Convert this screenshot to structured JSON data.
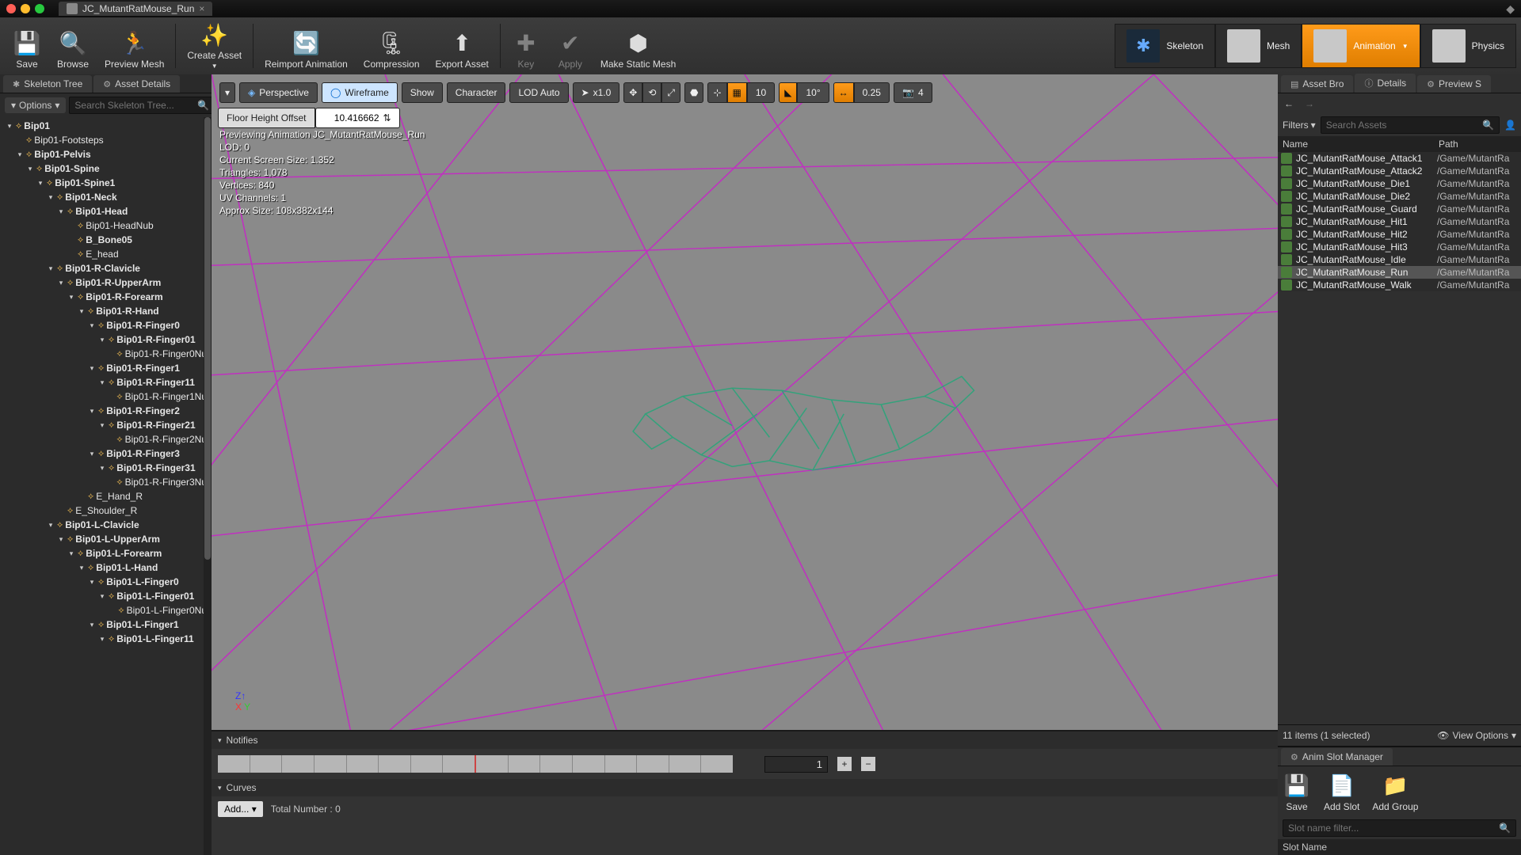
{
  "titlebar": {
    "tab_title": "JC_MutantRatMouse_Run"
  },
  "toolbar": {
    "save": "Save",
    "browse": "Browse",
    "preview_mesh": "Preview Mesh",
    "create_asset": "Create Asset",
    "reimport": "Reimport Animation",
    "compression": "Compression",
    "export": "Export Asset",
    "key": "Key",
    "apply": "Apply",
    "make_static": "Make Static Mesh"
  },
  "modes": {
    "skeleton": "Skeleton",
    "mesh": "Mesh",
    "animation": "Animation",
    "physics": "Physics"
  },
  "inner_tabs": {
    "skeleton_tree": "Skeleton Tree",
    "asset_details": "Asset Details"
  },
  "options_label": "Options",
  "search": {
    "placeholder": "Search Skeleton Tree..."
  },
  "bones": [
    {
      "d": 0,
      "t": "Bip01",
      "b": 1,
      "e": 1
    },
    {
      "d": 1,
      "t": "Bip01-Footsteps",
      "b": 0,
      "e": 0
    },
    {
      "d": 1,
      "t": "Bip01-Pelvis",
      "b": 1,
      "e": 1
    },
    {
      "d": 2,
      "t": "Bip01-Spine",
      "b": 1,
      "e": 1
    },
    {
      "d": 3,
      "t": "Bip01-Spine1",
      "b": 1,
      "e": 1
    },
    {
      "d": 4,
      "t": "Bip01-Neck",
      "b": 1,
      "e": 1
    },
    {
      "d": 5,
      "t": "Bip01-Head",
      "b": 1,
      "e": 1
    },
    {
      "d": 6,
      "t": "Bip01-HeadNub",
      "b": 0,
      "e": 0
    },
    {
      "d": 6,
      "t": "B_Bone05",
      "b": 1,
      "e": 0
    },
    {
      "d": 6,
      "t": "E_head",
      "b": 0,
      "e": 0
    },
    {
      "d": 4,
      "t": "Bip01-R-Clavicle",
      "b": 1,
      "e": 1
    },
    {
      "d": 5,
      "t": "Bip01-R-UpperArm",
      "b": 1,
      "e": 1
    },
    {
      "d": 6,
      "t": "Bip01-R-Forearm",
      "b": 1,
      "e": 1
    },
    {
      "d": 7,
      "t": "Bip01-R-Hand",
      "b": 1,
      "e": 1
    },
    {
      "d": 8,
      "t": "Bip01-R-Finger0",
      "b": 1,
      "e": 1
    },
    {
      "d": 9,
      "t": "Bip01-R-Finger01",
      "b": 1,
      "e": 1
    },
    {
      "d": 10,
      "t": "Bip01-R-Finger0Nu",
      "b": 0,
      "e": 0
    },
    {
      "d": 8,
      "t": "Bip01-R-Finger1",
      "b": 1,
      "e": 1
    },
    {
      "d": 9,
      "t": "Bip01-R-Finger11",
      "b": 1,
      "e": 1
    },
    {
      "d": 10,
      "t": "Bip01-R-Finger1Nu",
      "b": 0,
      "e": 0
    },
    {
      "d": 8,
      "t": "Bip01-R-Finger2",
      "b": 1,
      "e": 1
    },
    {
      "d": 9,
      "t": "Bip01-R-Finger21",
      "b": 1,
      "e": 1
    },
    {
      "d": 10,
      "t": "Bip01-R-Finger2Nu",
      "b": 0,
      "e": 0
    },
    {
      "d": 8,
      "t": "Bip01-R-Finger3",
      "b": 1,
      "e": 1
    },
    {
      "d": 9,
      "t": "Bip01-R-Finger31",
      "b": 1,
      "e": 1
    },
    {
      "d": 10,
      "t": "Bip01-R-Finger3Nu",
      "b": 0,
      "e": 0
    },
    {
      "d": 7,
      "t": "E_Hand_R",
      "b": 0,
      "e": 0
    },
    {
      "d": 5,
      "t": "E_Shoulder_R",
      "b": 0,
      "e": 0
    },
    {
      "d": 4,
      "t": "Bip01-L-Clavicle",
      "b": 1,
      "e": 1
    },
    {
      "d": 5,
      "t": "Bip01-L-UpperArm",
      "b": 1,
      "e": 1
    },
    {
      "d": 6,
      "t": "Bip01-L-Forearm",
      "b": 1,
      "e": 1
    },
    {
      "d": 7,
      "t": "Bip01-L-Hand",
      "b": 1,
      "e": 1
    },
    {
      "d": 8,
      "t": "Bip01-L-Finger0",
      "b": 1,
      "e": 1
    },
    {
      "d": 9,
      "t": "Bip01-L-Finger01",
      "b": 1,
      "e": 1
    },
    {
      "d": 10,
      "t": "Bip01-L-Finger0Nu",
      "b": 0,
      "e": 0
    },
    {
      "d": 8,
      "t": "Bip01-L-Finger1",
      "b": 1,
      "e": 1
    },
    {
      "d": 9,
      "t": "Bip01-L-Finger11",
      "b": 1,
      "e": 1
    }
  ],
  "viewport_toolbar": {
    "perspective": "Perspective",
    "wireframe": "Wireframe",
    "show": "Show",
    "character": "Character",
    "lod": "LOD Auto",
    "speed": "x1.0",
    "grid": "10",
    "angle": "10°",
    "snap": "0.25",
    "lod_num": "4"
  },
  "floor": {
    "label": "Floor Height Offset",
    "value": "10.416662"
  },
  "overlay": {
    "l1": "Previewing Animation JC_MutantRatMouse_Run",
    "l2": "LOD: 0",
    "l3": "Current Screen Size: 1.352",
    "l4": "Triangles: 1,078",
    "l5": "Vertices: 840",
    "l6": "UV Channels: 1",
    "l7": "Approx Size: 108x382x144"
  },
  "notifies": {
    "title": "Notifies",
    "value": "1"
  },
  "curves": {
    "title": "Curves",
    "add": "Add...",
    "total": "Total Number : 0"
  },
  "right_tabs": {
    "asset_bro": "Asset Bro",
    "details": "Details",
    "preview": "Preview S"
  },
  "filters": "Filters",
  "asset_search": {
    "placeholder": "Search Assets"
  },
  "asset_cols": {
    "name": "Name",
    "path": "Path"
  },
  "assets": [
    {
      "n": "JC_MutantRatMouse_Attack1",
      "p": "/Game/MutantRa"
    },
    {
      "n": "JC_MutantRatMouse_Attack2",
      "p": "/Game/MutantRa"
    },
    {
      "n": "JC_MutantRatMouse_Die1",
      "p": "/Game/MutantRa"
    },
    {
      "n": "JC_MutantRatMouse_Die2",
      "p": "/Game/MutantRa"
    },
    {
      "n": "JC_MutantRatMouse_Guard",
      "p": "/Game/MutantRa"
    },
    {
      "n": "JC_MutantRatMouse_Hit1",
      "p": "/Game/MutantRa"
    },
    {
      "n": "JC_MutantRatMouse_Hit2",
      "p": "/Game/MutantRa"
    },
    {
      "n": "JC_MutantRatMouse_Hit3",
      "p": "/Game/MutantRa"
    },
    {
      "n": "JC_MutantRatMouse_Idle",
      "p": "/Game/MutantRa"
    },
    {
      "n": "JC_MutantRatMouse_Run",
      "p": "/Game/MutantRa",
      "sel": true
    },
    {
      "n": "JC_MutantRatMouse_Walk",
      "p": "/Game/MutantRa"
    }
  ],
  "asset_status": "11 items (1 selected)",
  "view_options": "View Options",
  "slot_tab": "Anim Slot Manager",
  "slot_tb": {
    "save": "Save",
    "add_slot": "Add Slot",
    "add_group": "Add Group"
  },
  "slot_filter": {
    "placeholder": "Slot name filter..."
  },
  "slot_head": "Slot Name"
}
